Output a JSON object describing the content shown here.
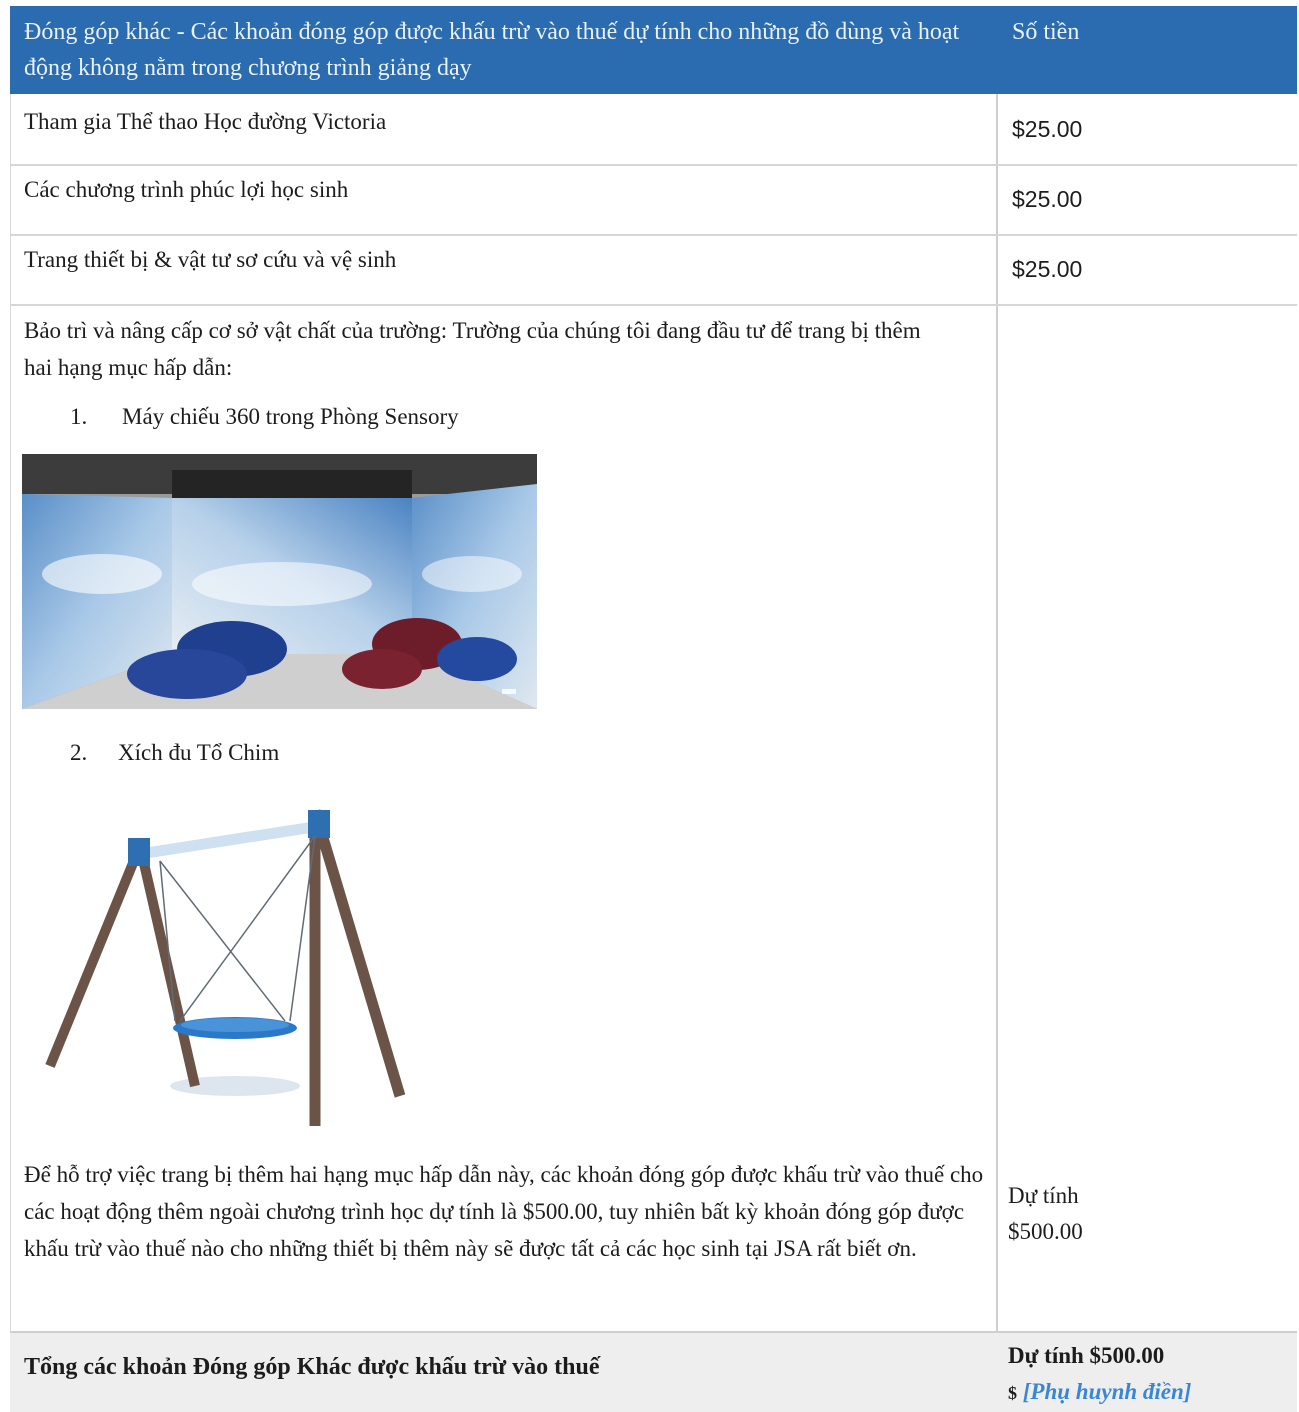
{
  "header": {
    "description": "Đóng góp khác - Các khoản đóng góp được khấu trừ vào thuế dự tính cho những đồ dùng và hoạt động không nằm trong chương trình giảng dạy",
    "amount": "Số tiền"
  },
  "rows": [
    {
      "label": "Tham gia Thể thao Học đường Victoria",
      "amount": "$25.00"
    },
    {
      "label": "Các chương trình phúc lợi học sinh",
      "amount": "$25.00"
    },
    {
      "label": "Trang thiết bị & vật tư sơ cứu và vệ sinh",
      "amount": "$25.00"
    }
  ],
  "facilities": {
    "intro": "Bảo trì và nâng cấp cơ sở vật chất của trường: Trường của chúng tôi đang đầu tư để trang bị thêm hai hạng mục hấp dẫn:",
    "items": [
      {
        "number": "1.",
        "text": "Máy chiếu 360 trong Phòng Sensory"
      },
      {
        "number": "2.",
        "text": "Xích đu Tổ Chim"
      }
    ],
    "closing": "Để hỗ trợ việc trang bị thêm hai hạng mục hấp dẫn này, các khoản đóng góp được khấu trừ vào thuế cho các hoạt động thêm ngoài chương trình học dự tính là $500.00, tuy nhiên bất kỳ khoản đóng góp được khấu trừ vào thuế nào cho những thiết bị thêm này sẽ được tất cả các học sinh tại JSA rất biết ơn.",
    "estimate_label": "Dự tính",
    "estimate_amount": "$500.00"
  },
  "total": {
    "label": "Tổng các khoản Đóng góp Khác được khấu trừ vào thuế",
    "estimate": "Dự tính $500.00",
    "dollar": "$",
    "fill_hint": "[Phụ huynh điền]"
  },
  "colors": {
    "header_bg": "#2b6cb0",
    "header_text": "#e9f1fb",
    "total_bg": "#eeeeee",
    "fill_hint": "#3a86d6"
  }
}
